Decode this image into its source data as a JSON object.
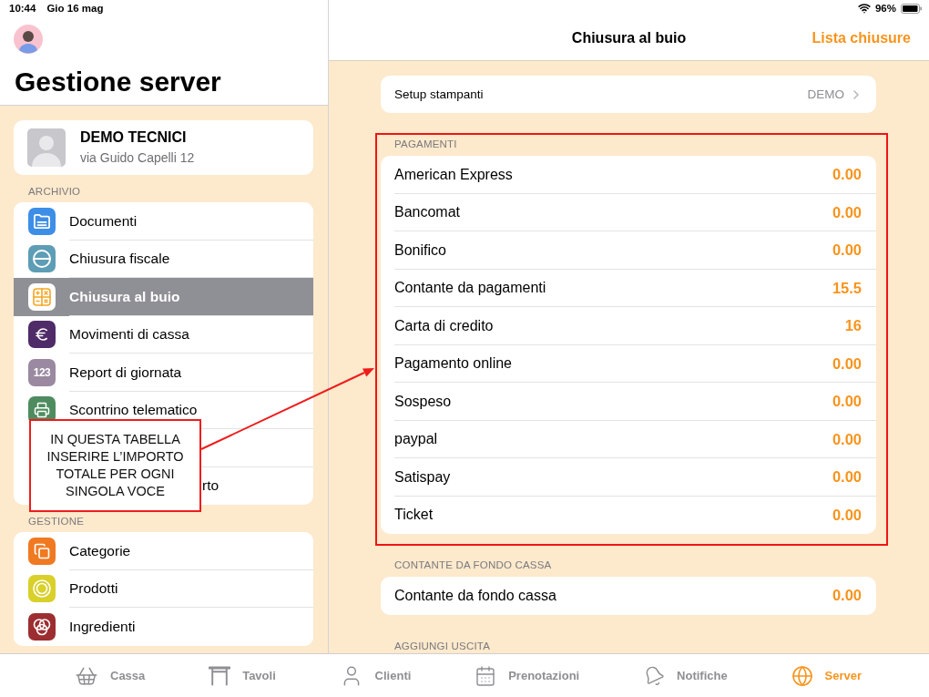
{
  "status_bar": {
    "time": "10:44",
    "date": "Gio 16 mag",
    "battery": "96%"
  },
  "sidebar": {
    "title": "Gestione server",
    "profile": {
      "name": "DEMO TECNICI",
      "address": "via Guido Capelli 12"
    },
    "sections": [
      {
        "header": "ARCHIVIO",
        "items": [
          {
            "kind": "row",
            "label": "Documenti",
            "selected": false
          },
          {
            "kind": "row",
            "label": "Chiusura fiscale",
            "selected": false
          },
          {
            "kind": "row",
            "label": "Chiusura al buio",
            "selected": true
          },
          {
            "kind": "row",
            "label": "Movimenti di cassa",
            "selected": false
          },
          {
            "kind": "row",
            "label": "Report di giornata",
            "selected": false,
            "icon_text": "123"
          },
          {
            "kind": "row",
            "label": "Scontrino telematico",
            "selected": false
          },
          {
            "kind": "covered",
            "label": "rto",
            "selected": false
          }
        ]
      },
      {
        "header": "GESTIONE",
        "items": [
          {
            "kind": "row",
            "label": "Categorie",
            "selected": false
          },
          {
            "kind": "row",
            "label": "Prodotti",
            "selected": false
          },
          {
            "kind": "row",
            "label": "Ingredienti",
            "selected": false
          }
        ]
      }
    ]
  },
  "annotation": {
    "text": "IN QUESTA TABELLA INSERIRE L’IMPORTO TOTALE PER OGNI SINGOLA VOCE"
  },
  "detail": {
    "title": "Chiusura al buio",
    "action": "Lista chiusure",
    "printer_setup": {
      "label": "Setup stampanti",
      "value": "DEMO"
    },
    "sections": [
      {
        "header": "PAGAMENTI",
        "highlighted": true,
        "rows": [
          {
            "label": "American Express",
            "value": "0.00"
          },
          {
            "label": "Bancomat",
            "value": "0.00"
          },
          {
            "label": "Bonifico",
            "value": "0.00"
          },
          {
            "label": "Contante da pagamenti",
            "value": "15.5"
          },
          {
            "label": "Carta di credito",
            "value": "16"
          },
          {
            "label": "Pagamento online",
            "value": "0.00"
          },
          {
            "label": "Sospeso",
            "value": "0.00"
          },
          {
            "label": "paypal",
            "value": "0.00"
          },
          {
            "label": "Satispay",
            "value": "0.00"
          },
          {
            "label": "Ticket",
            "value": "0.00"
          }
        ]
      },
      {
        "header": "CONTANTE DA FONDO CASSA",
        "highlighted": false,
        "rows": [
          {
            "label": "Contante da fondo cassa",
            "value": "0.00"
          }
        ]
      },
      {
        "header": "AGGIUNGI USCITA",
        "highlighted": false
      }
    ]
  },
  "tab_bar": [
    {
      "label": "Cassa",
      "selected": false
    },
    {
      "label": "Tavoli",
      "selected": false
    },
    {
      "label": "Clienti",
      "selected": false
    },
    {
      "label": "Prenotazioni",
      "selected": false
    },
    {
      "label": "Notifiche",
      "selected": false
    },
    {
      "label": "Server",
      "selected": true
    }
  ]
}
